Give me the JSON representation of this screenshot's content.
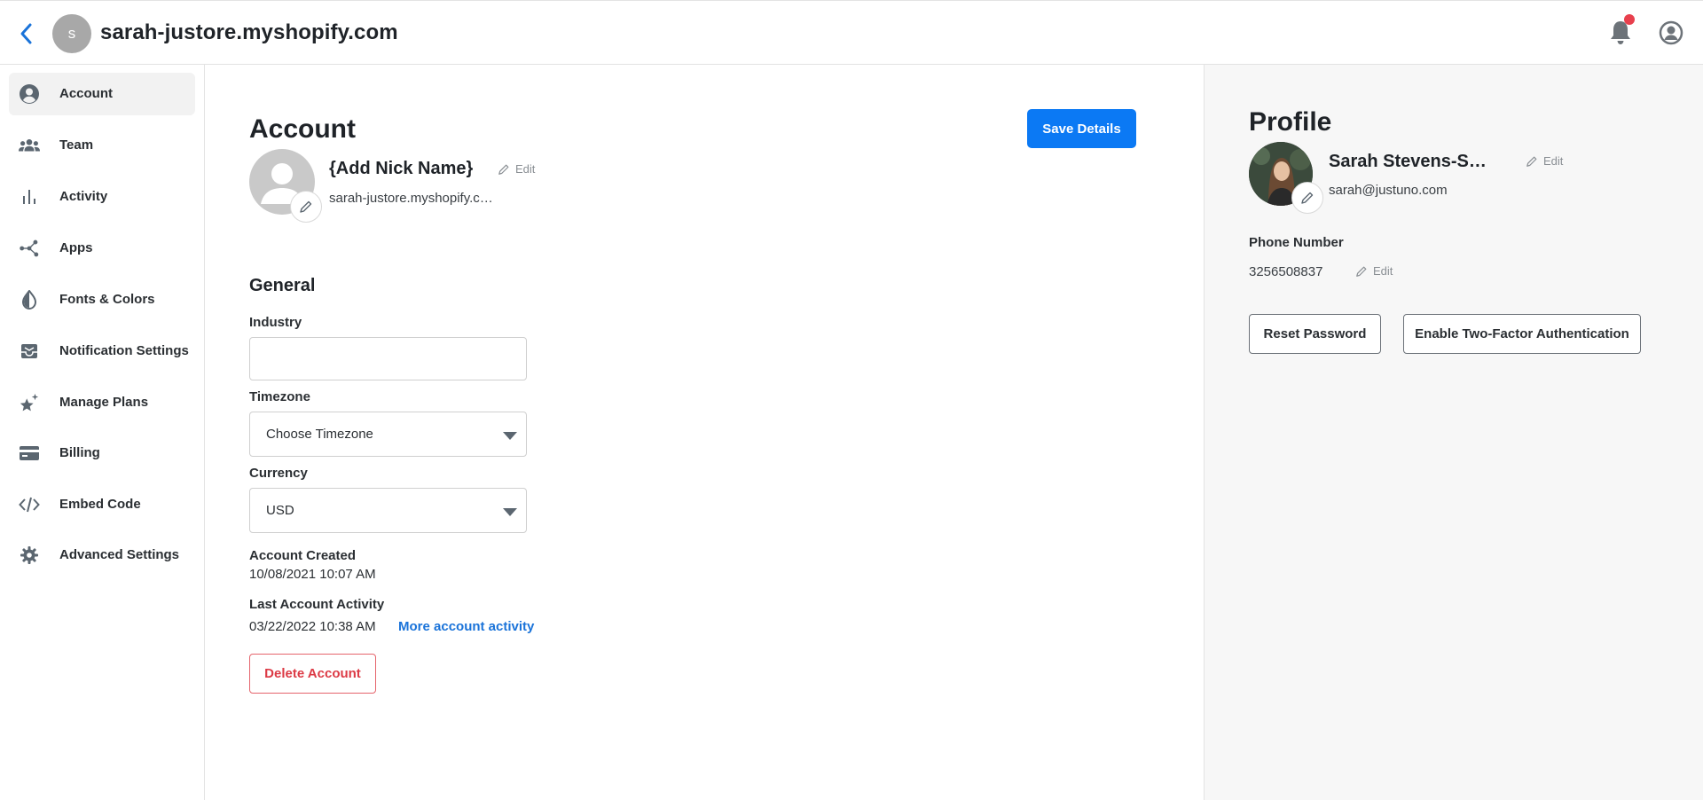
{
  "header": {
    "store_initial": "s",
    "store_title": "sarah-justore.myshopify.com"
  },
  "sidebar": {
    "items": [
      {
        "label": "Account",
        "icon": "account-circle-icon"
      },
      {
        "label": "Team",
        "icon": "team-icon"
      },
      {
        "label": "Activity",
        "icon": "bar-chart-icon"
      },
      {
        "label": "Apps",
        "icon": "apps-nodes-icon"
      },
      {
        "label": "Fonts & Colors",
        "icon": "contrast-drop-icon"
      },
      {
        "label": "Notification Settings",
        "icon": "inbox-icon"
      },
      {
        "label": "Manage Plans",
        "icon": "stars-icon"
      },
      {
        "label": "Billing",
        "icon": "credit-card-icon"
      },
      {
        "label": "Embed Code",
        "icon": "code-icon"
      },
      {
        "label": "Advanced Settings",
        "icon": "gear-icon"
      }
    ],
    "active_index": 0
  },
  "account": {
    "title": "Account",
    "save_label": "Save Details",
    "nick_name": "{Add Nick Name}",
    "edit_label": "Edit",
    "url": "sarah-justore.myshopify.com",
    "general_title": "General",
    "industry_label": "Industry",
    "industry_value": "",
    "timezone_label": "Timezone",
    "timezone_value": "Choose Timezone",
    "currency_label": "Currency",
    "currency_value": "USD",
    "created_label": "Account Created",
    "created_value": "10/08/2021 10:07 AM",
    "last_activity_label": "Last Account Activity",
    "last_activity_value": "03/22/2022 10:38 AM",
    "more_activity_label": "More account activity",
    "delete_label": "Delete Account"
  },
  "profile": {
    "title": "Profile",
    "name": "Sarah Stevens-Smith",
    "edit_label": "Edit",
    "email": "sarah@justuno.com",
    "phone_label": "Phone Number",
    "phone_value": "3256508837",
    "reset_label": "Reset Password",
    "two_factor_label": "Enable Two-Factor Authentication"
  },
  "colors": {
    "accent": "#0b79f4",
    "danger": "#dc3a45",
    "link": "#1a73d9",
    "notification_dot": "#e8404d"
  }
}
